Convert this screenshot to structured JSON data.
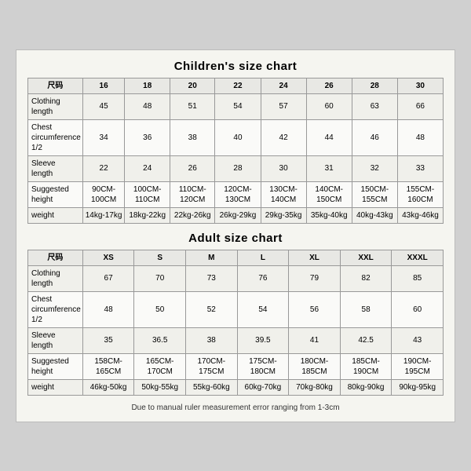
{
  "children_chart": {
    "title": "Children's size chart",
    "columns": [
      "尺码",
      "16",
      "18",
      "20",
      "22",
      "24",
      "26",
      "28",
      "30"
    ],
    "rows": [
      {
        "label": "Clothing\nlength",
        "values": [
          "45",
          "48",
          "51",
          "54",
          "57",
          "60",
          "63",
          "66"
        ]
      },
      {
        "label": "Chest\ncircumference\n1/2",
        "values": [
          "34",
          "36",
          "38",
          "40",
          "42",
          "44",
          "46",
          "48"
        ]
      },
      {
        "label": "Sleeve\nlength",
        "values": [
          "22",
          "24",
          "26",
          "28",
          "30",
          "31",
          "32",
          "33"
        ]
      },
      {
        "label": "Suggested\nheight",
        "values": [
          "90CM-100CM",
          "100CM-110CM",
          "110CM-120CM",
          "120CM-130CM",
          "130CM-140CM",
          "140CM-150CM",
          "150CM-155CM",
          "155CM-160CM"
        ]
      },
      {
        "label": "weight",
        "values": [
          "14kg-17kg",
          "18kg-22kg",
          "22kg-26kg",
          "26kg-29kg",
          "29kg-35kg",
          "35kg-40kg",
          "40kg-43kg",
          "43kg-46kg"
        ]
      }
    ]
  },
  "adult_chart": {
    "title": "Adult size chart",
    "columns": [
      "尺码",
      "XS",
      "S",
      "M",
      "L",
      "XL",
      "XXL",
      "XXXL"
    ],
    "rows": [
      {
        "label": "Clothing\nlength",
        "values": [
          "67",
          "70",
          "73",
          "76",
          "79",
          "82",
          "85"
        ]
      },
      {
        "label": "Chest\ncircumference\n1/2",
        "values": [
          "48",
          "50",
          "52",
          "54",
          "56",
          "58",
          "60"
        ]
      },
      {
        "label": "Sleeve\nlength",
        "values": [
          "35",
          "36.5",
          "38",
          "39.5",
          "41",
          "42.5",
          "43"
        ]
      },
      {
        "label": "Suggested\nheight",
        "values": [
          "158CM-165CM",
          "165CM-170CM",
          "170CM-175CM",
          "175CM-180CM",
          "180CM-185CM",
          "185CM-190CM",
          "190CM-195CM"
        ]
      },
      {
        "label": "weight",
        "values": [
          "46kg-50kg",
          "50kg-55kg",
          "55kg-60kg",
          "60kg-70kg",
          "70kg-80kg",
          "80kg-90kg",
          "90kg-95kg"
        ]
      }
    ]
  },
  "footer": {
    "note": "Due to manual ruler measurement error ranging from 1-3cm"
  }
}
